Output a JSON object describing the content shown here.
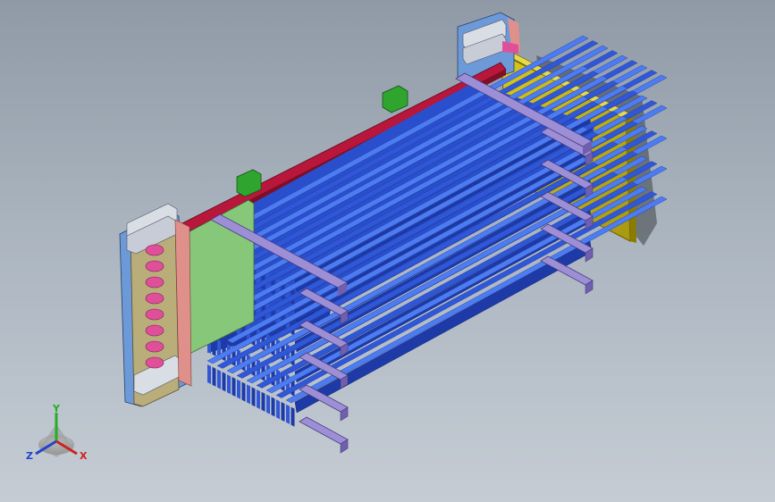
{
  "viewport": {
    "background_top": "#8f9aa6",
    "background_bottom": "#c5ccd4"
  },
  "model": {
    "colors": {
      "fin_blue": "#2f57d6",
      "fin_blue_dark": "#1d3aa6",
      "fin_blue_light": "#4d7bf0",
      "crossbar_purple": "#9d8fd6",
      "crossbar_purple_dark": "#6f5fae",
      "top_rail_red": "#b8163a",
      "pink_roller": "#e0509a",
      "end_plate_yellow": "#c9b810",
      "green_panel": "#86c77a",
      "green_bracket": "#2fa52f",
      "frame_tan": "#b9ad7a",
      "side_blue": "#6c9ad8",
      "salmon": "#e0908a"
    }
  },
  "triad": {
    "y_label": "Y",
    "z_label": "Z",
    "x_label": "X",
    "y_color": "#22b022",
    "z_color": "#2244cc",
    "x_color": "#cc2222"
  }
}
